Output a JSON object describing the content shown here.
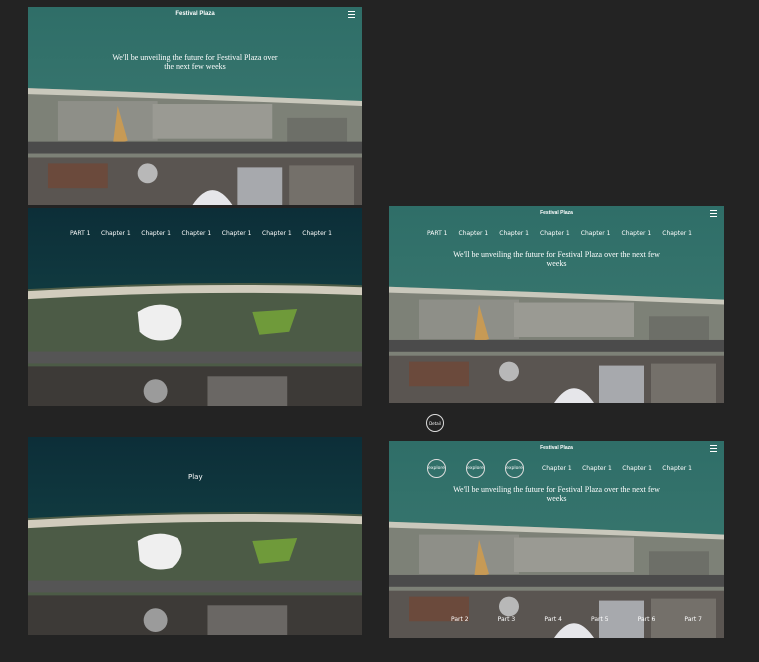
{
  "colors": {
    "bg": "#232323",
    "sea": "#2e6a66",
    "seaDark": "#0e3a44",
    "lot": "#8f8f88",
    "green": "#6a9a3c",
    "road": "#4a4a4a"
  },
  "frame1": {
    "title": "Festival Plaza",
    "headline": "We'll be unveiling the future for Festival Plaza over the next few weeks",
    "menu_icon": "hamburger-icon"
  },
  "frame2": {
    "nav": [
      "PART 1",
      "Chapter 1",
      "Chapter 1",
      "Chapter 1",
      "Chapter 1",
      "Chapter 1",
      "Chapter 1"
    ]
  },
  "frame3": {
    "title": "Festival Plaza",
    "headline": "We'll be unveiling the future for Festival Plaza over the next few weeks",
    "nav": [
      "PART 1",
      "Chapter 1",
      "Chapter 1",
      "Chapter 1",
      "Chapter 1",
      "Chapter 1",
      "Chapter 1"
    ],
    "menu_icon": "hamburger-icon"
  },
  "detail": {
    "label": "Detail"
  },
  "frame4": {
    "play": "Play"
  },
  "frame5": {
    "title": "Festival Plaza",
    "headline": "We'll be unveiling the future for Festival Plaza over the next few weeks",
    "explore": [
      "explore",
      "explore",
      "explore"
    ],
    "chapters": [
      "Chapter 1",
      "Chapter 1",
      "Chapter 1",
      "Chapter 1"
    ],
    "parts": [
      "Part 2",
      "Part 3",
      "Part 4",
      "Part 5",
      "Part 6",
      "Part 7"
    ],
    "menu_icon": "hamburger-icon"
  }
}
